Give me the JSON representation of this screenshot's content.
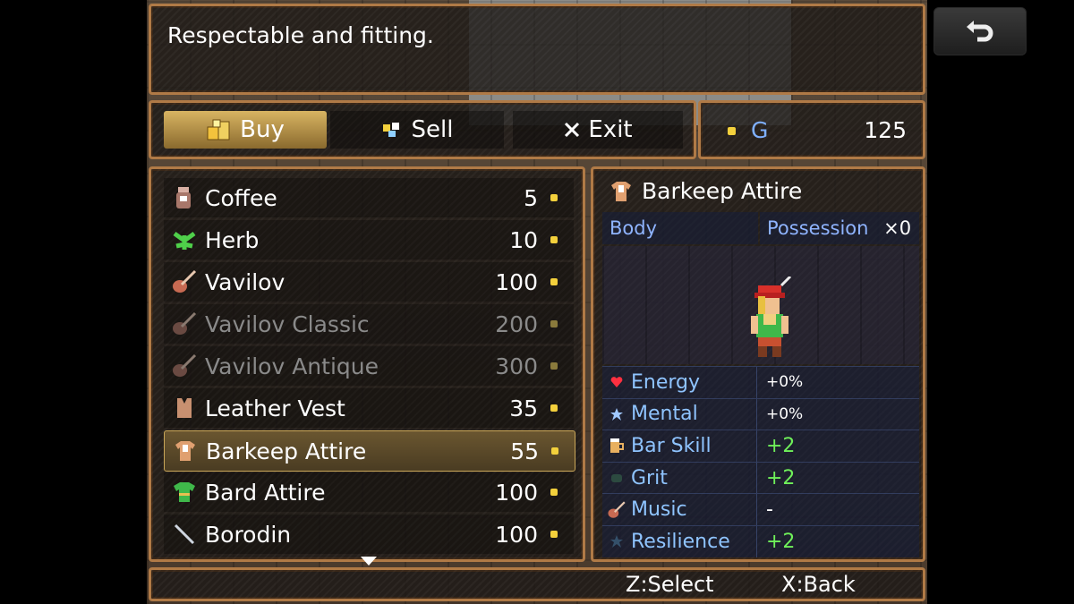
{
  "message": "Respectable and fitting.",
  "back_button": {
    "icon": "undo-arrow-icon"
  },
  "commands": [
    {
      "label": "Buy",
      "icon": "coins-icon",
      "selected": true
    },
    {
      "label": "Sell",
      "icon": "gems-icon",
      "selected": false
    },
    {
      "label": "Exit",
      "icon": "x-icon",
      "selected": false
    }
  ],
  "gold": {
    "unit": "G",
    "amount": "125"
  },
  "items": [
    {
      "name": "Coffee",
      "price": "5",
      "icon": "coffee-icon",
      "available": true
    },
    {
      "name": "Herb",
      "price": "10",
      "icon": "herb-icon",
      "available": true
    },
    {
      "name": "Vavilov",
      "price": "100",
      "icon": "guitar-icon",
      "available": true
    },
    {
      "name": "Vavilov Classic",
      "price": "200",
      "icon": "guitar-icon",
      "available": false
    },
    {
      "name": "Vavilov Antique",
      "price": "300",
      "icon": "guitar-icon",
      "available": false
    },
    {
      "name": "Leather Vest",
      "price": "35",
      "icon": "vest-icon",
      "available": true
    },
    {
      "name": "Barkeep Attire",
      "price": "55",
      "icon": "shirt-icon",
      "available": true,
      "selected": true
    },
    {
      "name": "Bard Attire",
      "price": "100",
      "icon": "tunic-icon",
      "available": true
    },
    {
      "name": "Borodin",
      "price": "100",
      "icon": "bow-icon",
      "available": true
    }
  ],
  "detail": {
    "title": "Barkeep Attire",
    "slot": "Body",
    "possession_label": "Possession",
    "possession_count": "×0",
    "stats": [
      {
        "name": "Energy",
        "value": "+0%",
        "icon": "heart-icon"
      },
      {
        "name": "Mental",
        "value": "+0%",
        "icon": "star-icon"
      },
      {
        "name": "Bar Skill",
        "value": "+2",
        "icon": "mug-icon"
      },
      {
        "name": "Grit",
        "value": "+2",
        "icon": "fist-icon"
      },
      {
        "name": "Music",
        "value": "-",
        "icon": "guitar-icon"
      },
      {
        "name": "Resilience",
        "value": "+2",
        "icon": "shield-icon"
      }
    ]
  },
  "help": {
    "select": "Z:Select",
    "back": "X:Back"
  }
}
